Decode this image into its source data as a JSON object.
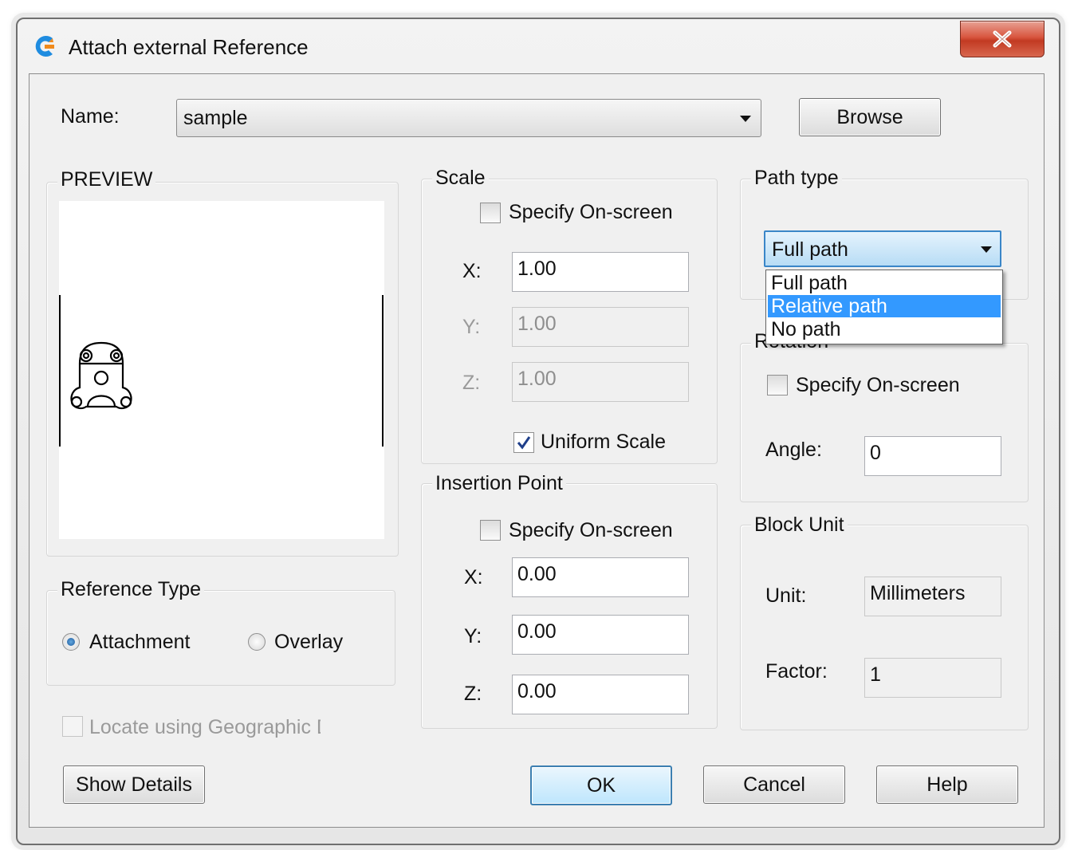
{
  "window": {
    "title": "Attach external Reference",
    "close_label": "x"
  },
  "name_row": {
    "label": "Name:",
    "value": "sample",
    "browse_label": "Browse"
  },
  "preview": {
    "title": "PREVIEW"
  },
  "scale": {
    "title": "Scale",
    "specify_on_screen_label": "Specify On-screen",
    "specify_on_screen_checked": false,
    "x_label": "X:",
    "x_value": "1.00",
    "y_label": "Y:",
    "y_value": "1.00",
    "z_label": "Z:",
    "z_value": "1.00",
    "uniform_scale_label": "Uniform Scale",
    "uniform_scale_checked": true
  },
  "insertion_point": {
    "title": "Insertion Point",
    "specify_on_screen_label": "Specify On-screen",
    "specify_on_screen_checked": false,
    "x_label": "X:",
    "x_value": "0.00",
    "y_label": "Y:",
    "y_value": "0.00",
    "z_label": "Z:",
    "z_value": "0.00"
  },
  "path_type": {
    "title": "Path type",
    "selected": "Full path",
    "options": [
      "Full path",
      "Relative path",
      "No path"
    ],
    "highlighted_option": "Relative path"
  },
  "rotation": {
    "title": "Rotation",
    "specify_on_screen_label": "Specify On-screen",
    "specify_on_screen_checked": false,
    "angle_label": "Angle:",
    "angle_value": "0"
  },
  "block_unit": {
    "title": "Block Unit",
    "unit_label": "Unit:",
    "unit_value": "Millimeters",
    "factor_label": "Factor:",
    "factor_value": "1"
  },
  "reference_type": {
    "title": "Reference Type",
    "attachment_label": "Attachment",
    "overlay_label": "Overlay",
    "selected": "Attachment"
  },
  "geographic": {
    "label": "Locate using Geographic D",
    "checked": false
  },
  "buttons": {
    "show_details": "Show Details",
    "ok": "OK",
    "cancel": "Cancel",
    "help": "Help"
  },
  "colors": {
    "accent": "#3399ff",
    "close_button": "#d8553e",
    "default_button_border": "#3c7fb1"
  }
}
